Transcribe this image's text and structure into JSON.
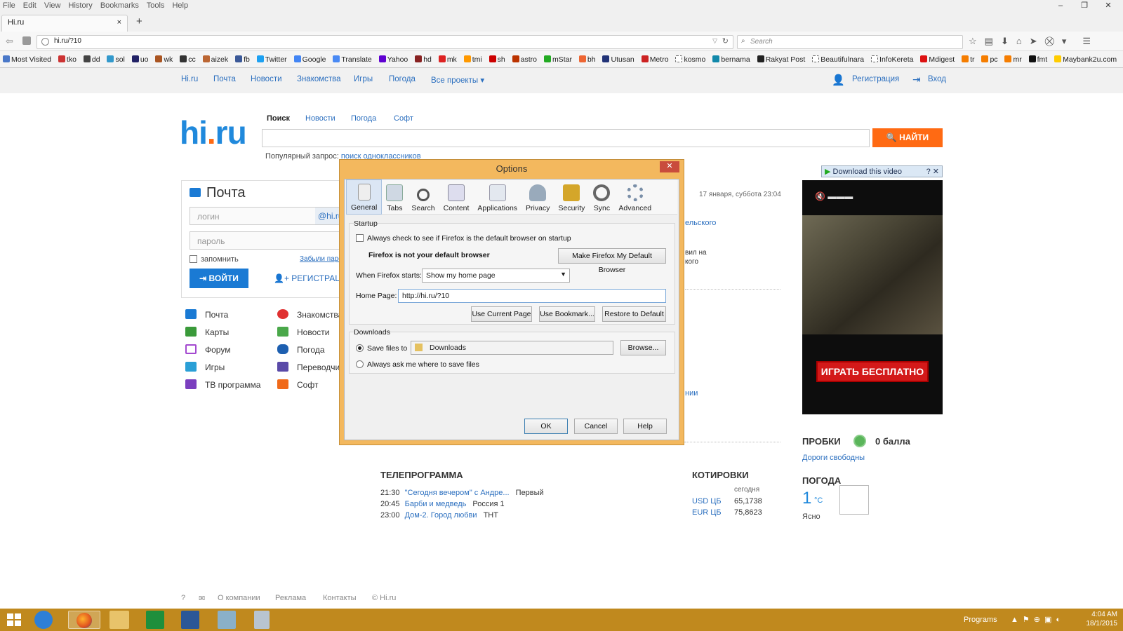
{
  "browser": {
    "menu": [
      "File",
      "Edit",
      "View",
      "History",
      "Bookmarks",
      "Tools",
      "Help"
    ],
    "tab_title": "Hi.ru",
    "tab_close": "×",
    "new_tab": "+",
    "url": "hi.ru/?10",
    "search_placeholder": "Search",
    "bookmarks": [
      "Most Visited",
      "tko",
      "dd",
      "sol",
      "uo",
      "wk",
      "cc",
      "aizek",
      "fb",
      "Twitter",
      "Google",
      "Translate",
      "Yahoo",
      "hd",
      "mk",
      "tmi",
      "sh",
      "astro",
      "mStar",
      "bh",
      "Utusan",
      "Metro",
      "kosmo",
      "bernama",
      "Rakyat Post",
      "Beautifulnara",
      "InfoKereta",
      "Mdigest",
      "tr",
      "pc",
      "mr",
      "fmt",
      "Maybank2u.com"
    ]
  },
  "site": {
    "nav": [
      "Hi.ru",
      "Почта",
      "Новости",
      "Знакомства",
      "Игры",
      "Погода",
      "Все проекты ▾"
    ],
    "register": "Регистрация",
    "login": "Вход",
    "logo_main": "hi",
    "logo_dot": ".",
    "logo_tld": "ru",
    "search_tabs": [
      "Поиск",
      "Новости",
      "Погода",
      "Софт"
    ],
    "search_button": "НАЙТИ",
    "popular_label": "Популярный запрос:",
    "popular_link": "поиск одноклассников",
    "mail": {
      "title": "Почта",
      "login_placeholder": "логин",
      "domain": "@hi.ru",
      "password_placeholder": "пароль",
      "remember": "запомнить",
      "forgot": "Забыли пароль?",
      "enter_button": "ВОЙТИ",
      "register_button": "РЕГИСТРАЦИЯ"
    },
    "services_left": [
      "Почта",
      "Карты",
      "Форум",
      "Игры",
      "ТВ программа"
    ],
    "services_right": [
      "Знакомства",
      "Новости",
      "Погода",
      "Переводчик",
      "Софт"
    ],
    "date": "17 января, суббота 23:04",
    "fragments": [
      "ельского",
      "вил на",
      "кого",
      "нии"
    ],
    "tv": {
      "title": "ТЕЛЕПРОГРАММА",
      "rows": [
        {
          "time": "21:30",
          "show": "\"Сегодня вечером\" с Андре...",
          "channel": "Первый"
        },
        {
          "time": "20:45",
          "show": "Барби и медведь",
          "channel": "Россия 1"
        },
        {
          "time": "23:00",
          "show": "Дом-2. Город любви",
          "channel": "ТНТ"
        }
      ]
    },
    "quotes": {
      "title": "КОТИРОВКИ",
      "today": "сегодня",
      "rows": [
        {
          "name": "USD ЦБ",
          "value": "65,1738"
        },
        {
          "name": "EUR ЦБ",
          "value": "75,8623"
        }
      ]
    },
    "traffic": {
      "title": "ПРОБКИ",
      "score": "0 балла",
      "status": "Дороги свободны"
    },
    "weather": {
      "title": "ПОГОДА",
      "temp": "1",
      "unit": "°C",
      "desc": "Ясно"
    },
    "ad": {
      "download_label": "Download this video",
      "button": "ИГРАТЬ БЕСПЛАТНО"
    },
    "footer": [
      "О компании",
      "Реклама",
      "Контакты",
      "© Hi.ru"
    ]
  },
  "dialog": {
    "title": "Options",
    "close": "✕",
    "tabs": [
      "General",
      "Tabs",
      "Search",
      "Content",
      "Applications",
      "Privacy",
      "Security",
      "Sync",
      "Advanced"
    ],
    "startup_label": "Startup",
    "always_check": "Always check to see if Firefox is the default browser on startup",
    "not_default": "Firefox is not your default browser",
    "make_default_button": "Make Firefox My Default Browser",
    "when_starts_label": "When Firefox starts:",
    "when_starts_value": "Show my home page",
    "home_page_label": "Home Page:",
    "home_page_value": "http://hi.ru/?10",
    "use_current": "Use Current Page",
    "use_bookmark": "Use Bookmark...",
    "restore_default": "Restore to Default",
    "downloads_label": "Downloads",
    "save_files_to": "Save files to",
    "downloads_folder": "Downloads",
    "browse_button": "Browse...",
    "always_ask": "Always ask me where to save files",
    "ok": "OK",
    "cancel": "Cancel",
    "help": "Help"
  },
  "taskbar": {
    "programs": "Programs",
    "time": "4:04 AM",
    "date": "18/1/2015"
  }
}
